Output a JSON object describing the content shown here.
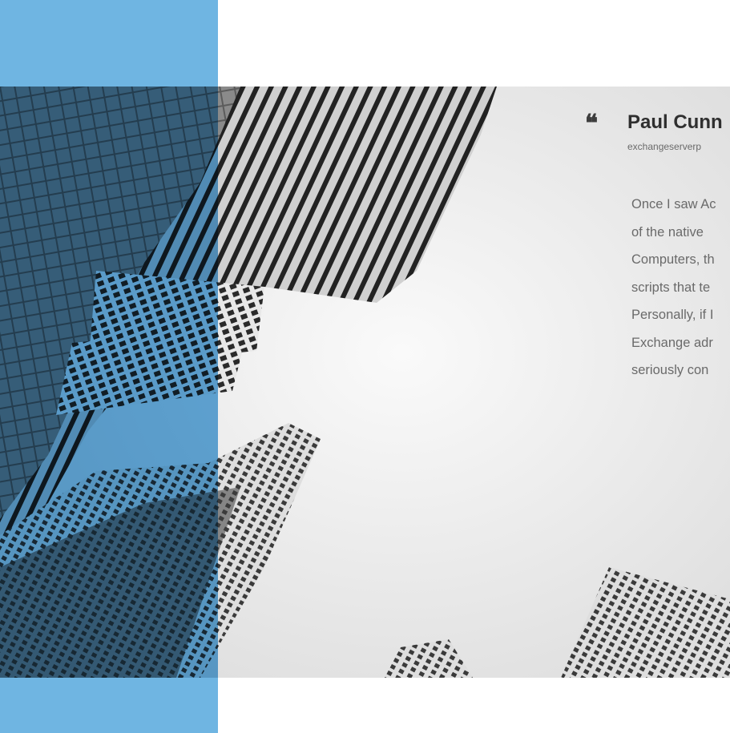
{
  "testimonial": {
    "author": "Paul Cunn",
    "source": "exchangeserverp",
    "lines": [
      "Once I saw Ac",
      "of the native",
      "Computers, th",
      "scripts that te",
      "Personally, if I",
      "Exchange adr",
      "seriously con"
    ]
  },
  "icons": {
    "quote": "quote-icon"
  },
  "colors": {
    "accent_blue": "#6fb5e2",
    "text_dark": "#2f2f2f",
    "text_muted": "#6a6a6a"
  }
}
